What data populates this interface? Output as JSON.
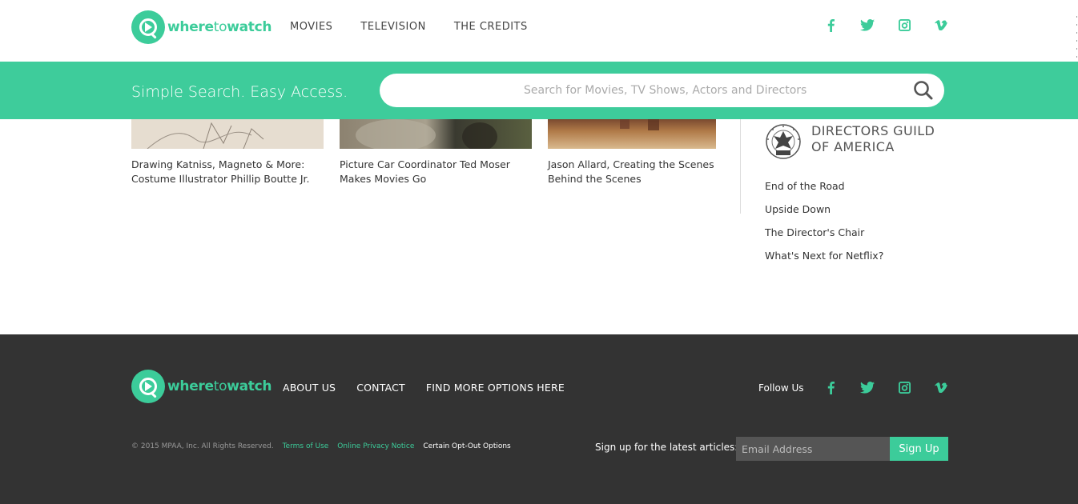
{
  "brand": {
    "name_part1": "where",
    "name_part2": "to",
    "name_part3": "watch",
    "accent": "#3ccc9a"
  },
  "header": {
    "nav": [
      "MOVIES",
      "TELEVISION",
      "THE CREDITS"
    ],
    "social_icons": [
      "facebook-icon",
      "twitter-icon",
      "instagram-icon",
      "vimeo-icon"
    ]
  },
  "search": {
    "tagline": "Simple Search. Easy Access.",
    "placeholder": "Search for Movies, TV Shows, Actors and Directors"
  },
  "articles": [
    {
      "title": "Drawing Katniss, Magneto & More: Costume Illustrator Phillip Boutte Jr."
    },
    {
      "title": "Picture Car Coordinator Ted Moser Makes Movies Go"
    },
    {
      "title": "Jason Allard, Creating the Scenes Behind the Scenes"
    }
  ],
  "sidebar": {
    "dga_title_line1": "DIRECTORS GUILD",
    "dga_title_line2": "OF AMERICA",
    "links": [
      "End of the Road",
      "Upside Down",
      "The Director's Chair",
      "What's Next for Netflix?"
    ]
  },
  "footer": {
    "nav": [
      "ABOUT US",
      "CONTACT",
      "FIND MORE OPTIONS HERE"
    ],
    "follow_label": "Follow Us",
    "copyright": "© 2015 MPAA, Inc. All Rights Reserved.",
    "terms": "Terms of Use",
    "privacy": "Online Privacy Notice",
    "optout": "Certain Opt-Out Options",
    "signup_label": "Sign up for the latest articles:",
    "email_placeholder": "Email Address",
    "signup_button": "Sign Up",
    "background": "#333333"
  }
}
